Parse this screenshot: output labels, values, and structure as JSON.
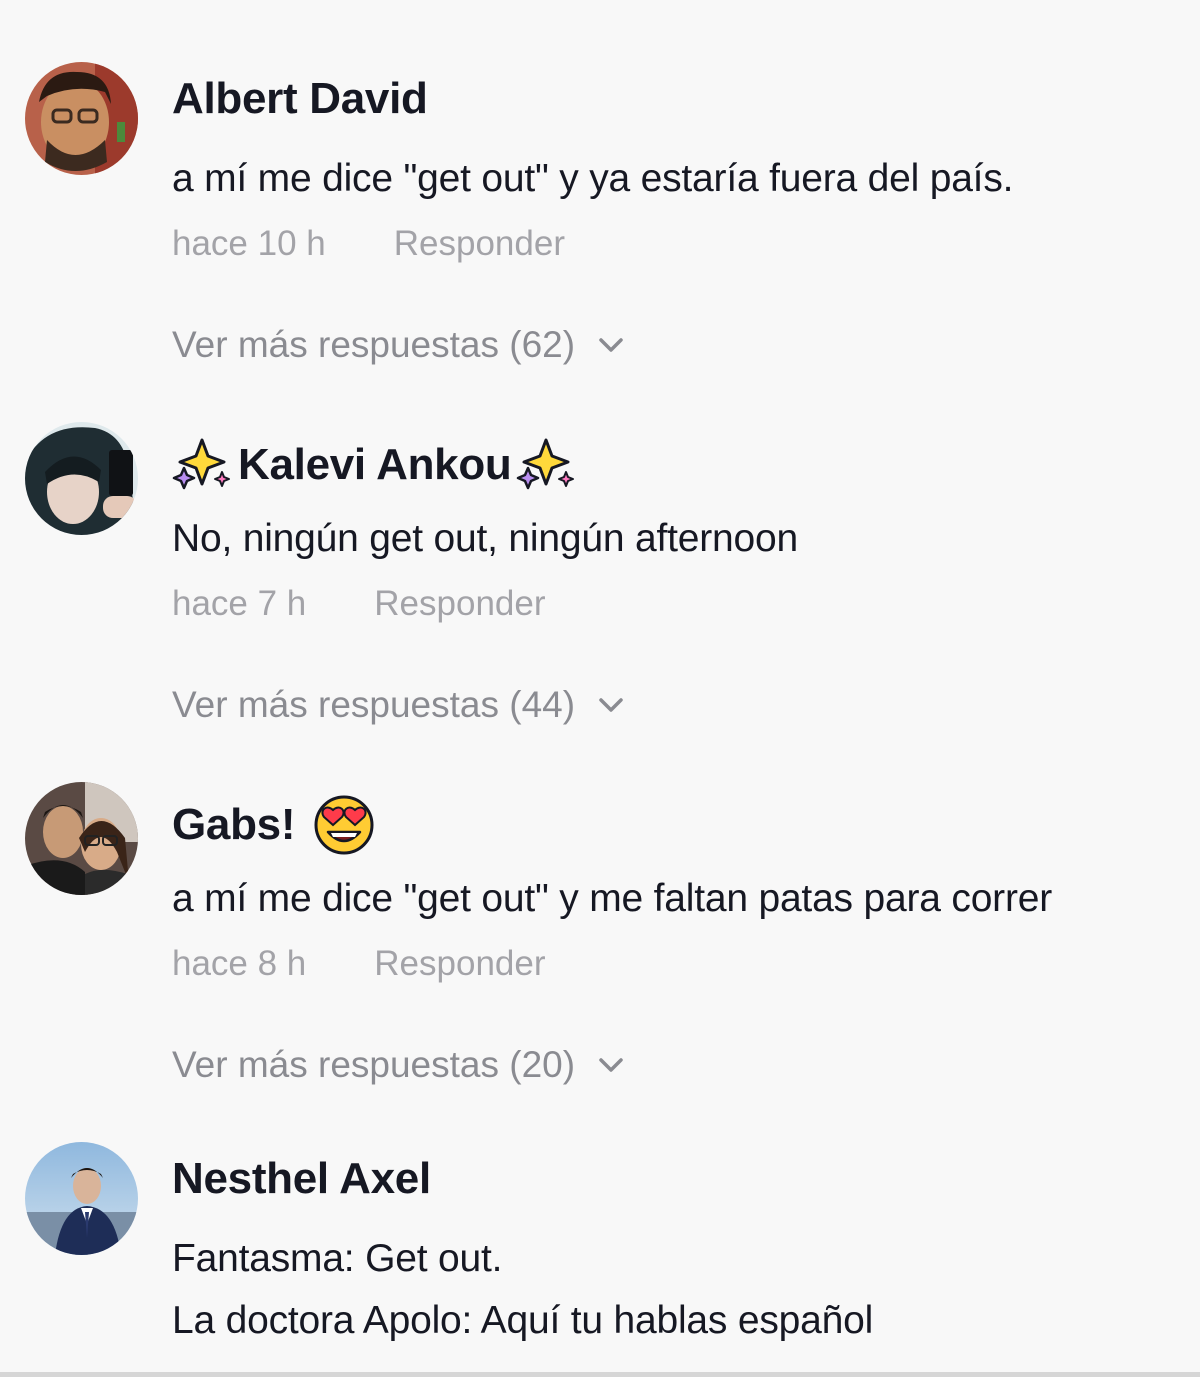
{
  "comments": [
    {
      "username": "Albert David",
      "text": [
        "a mí me dice \"get out\" y ya estaría fuera del país."
      ],
      "time": "hace 10 h",
      "reply": "Responder",
      "more": "Ver más respuestas (62)"
    },
    {
      "username": "Kalevi Ankou",
      "text": [
        "No, ningún get out, ningún afternoon"
      ],
      "time": "hace 7 h",
      "reply": "Responder",
      "more": "Ver más respuestas (44)"
    },
    {
      "username": "Gabs!",
      "text": [
        "a mí me dice \"get out\" y me faltan patas para correr"
      ],
      "time": "hace 8 h",
      "reply": "Responder",
      "more": "Ver más respuestas (20)"
    },
    {
      "username": "Nesthel Axel",
      "text": [
        "Fantasma: Get out.",
        "La doctora Apolo: Aquí tu hablas español"
      ]
    }
  ],
  "icons": {
    "expand": "chevron-down-icon",
    "sparkles": "sparkles-emoji",
    "heart_eyes": "heart-eyes-emoji"
  },
  "colors": {
    "background": "#f8f8f8",
    "username": "#161823",
    "meta": "#a3a3a8"
  }
}
